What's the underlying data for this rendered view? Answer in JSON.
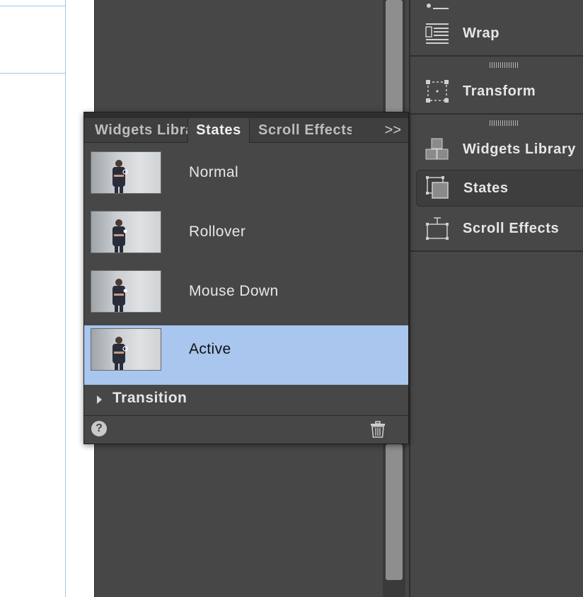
{
  "dock": {
    "items": [
      {
        "label": "Wrap",
        "icon": "wrap-icon"
      },
      {
        "label": "Transform",
        "icon": "transform-icon"
      },
      {
        "label": "Widgets Library",
        "icon": "widgets-library-icon"
      },
      {
        "label": "States",
        "icon": "states-icon"
      },
      {
        "label": "Scroll Effects",
        "icon": "scroll-effects-icon"
      }
    ]
  },
  "panel": {
    "tabs": [
      {
        "label": "Widgets Library"
      },
      {
        "label": "States"
      },
      {
        "label": "Scroll Effects"
      }
    ],
    "more_label": ">>",
    "states": [
      {
        "label": "Normal"
      },
      {
        "label": "Rollover"
      },
      {
        "label": "Mouse Down"
      },
      {
        "label": "Active"
      }
    ],
    "transition_label": "Transition",
    "help_label": "?"
  },
  "colors": {
    "panel_bg": "#474747",
    "selected_row": "#a8c6ee",
    "guide_line": "#9cc8ee"
  }
}
